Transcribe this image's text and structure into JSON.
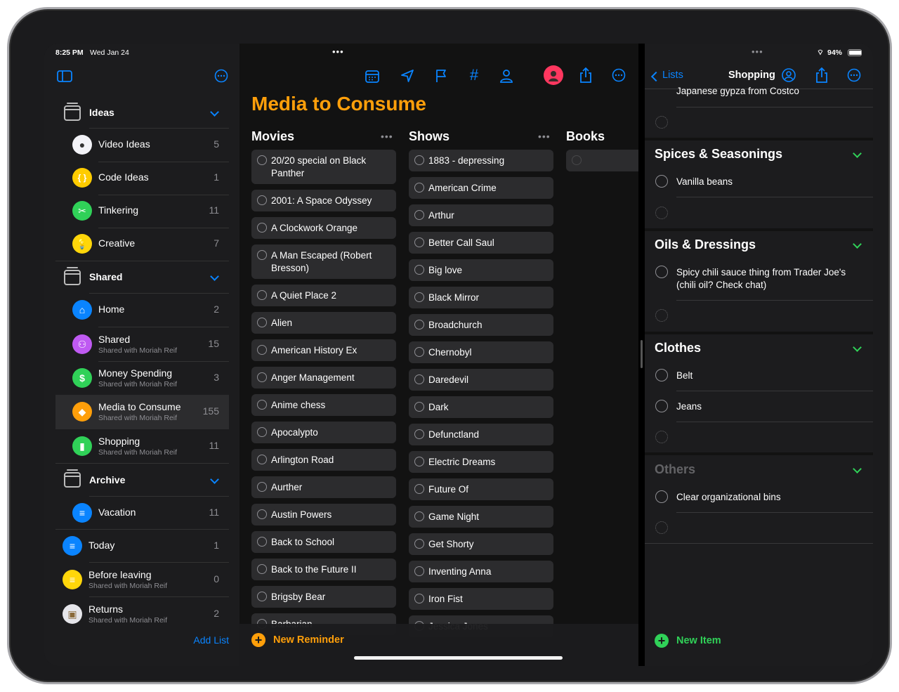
{
  "status": {
    "time": "8:25 PM",
    "date": "Wed Jan 24",
    "battery": "94%"
  },
  "sidebar": {
    "groups": {
      "ideas": "Ideas",
      "shared": "Shared",
      "archive": "Archive"
    },
    "items": [
      {
        "label": "Video Ideas",
        "count": "5",
        "icon": "camera-icon",
        "color": "#f2f2f7"
      },
      {
        "label": "Code Ideas",
        "count": "1",
        "icon": "braces-icon",
        "color": "#ffcc00"
      },
      {
        "label": "Tinkering",
        "count": "11",
        "icon": "tools-icon",
        "color": "#30d158"
      },
      {
        "label": "Creative",
        "count": "7",
        "icon": "lightbulb-icon",
        "color": "#ffd60a"
      },
      {
        "label": "Home",
        "count": "2",
        "icon": "house-icon",
        "color": "#0a84ff"
      },
      {
        "label": "Shared",
        "subtitle": "Shared with Moriah Reif",
        "count": "15",
        "icon": "people-icon",
        "color": "#bf5af2"
      },
      {
        "label": "Money Spending",
        "subtitle": "Shared with Moriah Reif",
        "count": "3",
        "icon": "money-icon",
        "color": "#30d158"
      },
      {
        "label": "Media to Consume",
        "subtitle": "Shared with Moriah Reif",
        "count": "155",
        "icon": "diamond-icon",
        "color": "#ff9f0a"
      },
      {
        "label": "Shopping",
        "subtitle": "Shared with Moriah Reif",
        "count": "11",
        "icon": "bag-icon",
        "color": "#30d158"
      },
      {
        "label": "Vacation",
        "count": "11",
        "icon": "list-icon",
        "color": "#0a84ff"
      },
      {
        "label": "Today",
        "count": "1",
        "icon": "list-icon",
        "color": "#0a84ff"
      },
      {
        "label": "Before leaving",
        "subtitle": "Shared with Moriah Reif",
        "count": "0",
        "icon": "list-icon",
        "color": "#ffd60a"
      },
      {
        "label": "Returns",
        "subtitle": "Shared with Moriah Reif",
        "count": "2",
        "icon": "box-icon",
        "color": "#e5e5ea"
      }
    ],
    "add_list": "Add List"
  },
  "main": {
    "title": "Media to Consume",
    "columns": [
      {
        "title": "Movies",
        "items": [
          "20/20 special on Black Panther",
          "2001: A Space Odyssey",
          "A Clockwork Orange",
          "A Man Escaped (Robert Bresson)",
          "A Quiet Place 2",
          "Alien",
          "American History Ex",
          "Anger Management",
          "Anime chess",
          "Apocalypto",
          "Arlington Road",
          "Aurther",
          "Austin Powers",
          "Back to School",
          "Back to the Future II",
          "Brigsby Bear",
          "Barbarian"
        ]
      },
      {
        "title": "Shows",
        "items": [
          "1883 - depressing",
          "American Crime",
          "Arthur",
          "Better Call Saul",
          "Big love",
          "Black Mirror",
          "Broadchurch",
          "Chernobyl",
          "Daredevil",
          "Dark",
          "Defunctland",
          "Electric Dreams",
          "Future Of",
          "Game Night",
          "Get Shorty",
          "Inventing Anna",
          "Iron Fist",
          "Jessica Jones"
        ]
      },
      {
        "title": "Books",
        "items": [
          ""
        ]
      }
    ],
    "new_reminder": "New Reminder",
    "accent": "#ff9f0a"
  },
  "detail": {
    "back_label": "Lists",
    "title": "Shopping",
    "top_item": "Japanese gypza from Costco",
    "sections": [
      {
        "title": "Spices & Seasonings",
        "items": [
          "Vanilla beans"
        ]
      },
      {
        "title": "Oils & Dressings",
        "items": [
          "Spicy chili sauce thing from Trader Joe's (chili oil? Check chat)"
        ]
      },
      {
        "title": "Clothes",
        "items": [
          "Belt",
          "Jeans"
        ]
      },
      {
        "title": "Others",
        "items": [
          "Clear organizational bins"
        ]
      }
    ],
    "new_item": "New Item",
    "accent": "#30d158"
  }
}
